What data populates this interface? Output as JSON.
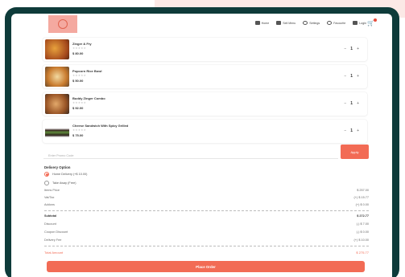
{
  "nav": {
    "items": [
      {
        "label": "Home",
        "icon": "home-icon"
      },
      {
        "label": "Sell Menu",
        "icon": "menu-icon"
      },
      {
        "label": "Settings",
        "icon": "gear-icon"
      },
      {
        "label": "Favourite",
        "icon": "heart-icon"
      },
      {
        "label": "Login",
        "icon": "lock-icon"
      }
    ],
    "cart_icon": "cart-icon"
  },
  "cart_items": [
    {
      "name": "Zinger & Fry",
      "stars": "★★★★★",
      "price": "$ 80.00",
      "qty": "1"
    },
    {
      "name": "Popcorn Rice Bowl",
      "stars": "★★★★★",
      "price": "$ 50.00",
      "qty": "1"
    },
    {
      "name": "Buddy Zinger Combo",
      "stars": "★★★★★",
      "price": "$ 92.00",
      "qty": "1"
    },
    {
      "name": "Cheese Sandwich With Spicy Grilled",
      "stars": "★★★★★",
      "price": "$ 75.00",
      "qty": "1"
    }
  ],
  "promo": {
    "placeholder": "Enter Promo Code",
    "apply_label": "Apply"
  },
  "delivery": {
    "title": "Delivery Option",
    "options": [
      {
        "label": "Home Delivery (+$ 10.00)",
        "selected": true
      },
      {
        "label": "Take Away (Free)",
        "selected": false
      }
    ]
  },
  "summary": {
    "items_price": {
      "label": "Items Price",
      "value": "$ 257.00"
    },
    "vat_tax": {
      "label": "Vat/Tax",
      "value": "(+) $ 15.77"
    },
    "addons": {
      "label": "Addons",
      "value": "(+) $ 0.00"
    },
    "subtotal": {
      "label": "Subtotal",
      "value": "$ 272.77"
    },
    "discount": {
      "label": "Discount",
      "value": "(-) $ 7.00"
    },
    "coupon": {
      "label": "Coupon Discount",
      "value": "(-) $ 0.00"
    },
    "delivery_fee": {
      "label": "Delivery Fee",
      "value": "(+) $ 10.00"
    },
    "total": {
      "label": "Total Amount",
      "value": "$ 275.77"
    }
  },
  "place_order_label": "Place Order",
  "colors": {
    "accent": "#f26b55",
    "frame": "#0e3b3a",
    "logo_bg": "#f4a9a0"
  }
}
